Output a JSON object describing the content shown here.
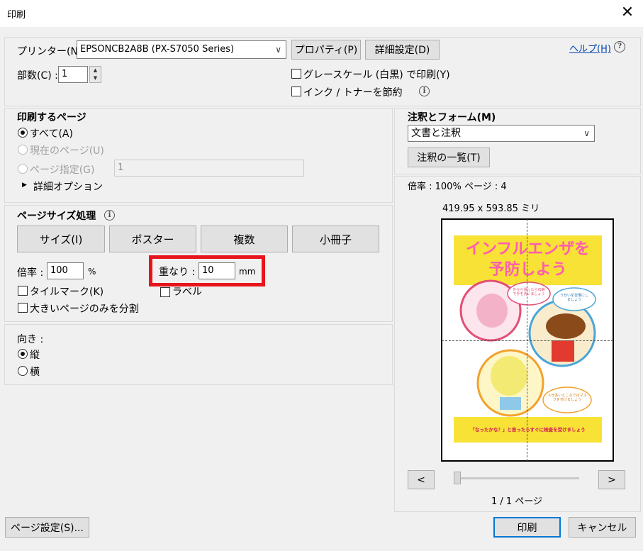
{
  "window": {
    "title": "印刷",
    "close_glyph": "✕"
  },
  "printer": {
    "label": "プリンター(N) :",
    "selected": "EPSONCB2A8B (PX-S7050 Series)",
    "properties_button": "プロパティ(P)",
    "advanced_button": "詳細設定(D)",
    "help_link": "ヘルプ(H)",
    "help_icon": "?",
    "copies_label": "部数(C) :",
    "copies_value": "1",
    "grayscale_label": "グレースケール (白黒) で印刷(Y)",
    "save_ink_label": "インク / トナーを節約"
  },
  "pages_to_print": {
    "title": "印刷するページ",
    "all": "すべて(A)",
    "current": "現在のページ(U)",
    "pages": "ページ指定(G)",
    "pages_value": "1",
    "more_options": "詳細オプション",
    "triangle": "▶"
  },
  "page_sizing": {
    "title": "ページサイズ処理",
    "buttons": [
      "サイズ(I)",
      "ポスター",
      "複数",
      "小冊子"
    ],
    "scale_label": "倍率 :",
    "scale_value": "100",
    "scale_unit": "%",
    "overlap_label": "重なり :",
    "overlap_value": "10",
    "overlap_unit": "mm",
    "tile_marks": "タイルマーク(K)",
    "labels": "ラベル",
    "large_pages_only": "大きいページのみを分割"
  },
  "orientation": {
    "title": "向き :",
    "portrait": "縦",
    "landscape": "横"
  },
  "comments_forms": {
    "title": "注釈とフォーム(M)",
    "selected": "文書と注釈",
    "summarize_button": "注釈の一覧(T)"
  },
  "preview": {
    "scale_info": "倍率 : 100% ページ : 4",
    "dimensions": "419.95 x 593.85 ミリ",
    "page_counter": "1 / 1 ページ",
    "prev": "<",
    "next": ">",
    "poster": {
      "title_line1": "インフルエンザを",
      "title_line2": "予防しよう",
      "bubble1": "外から帰ったら石鹸で手を洗いましょう",
      "bubble2": "うがいを習慣にしましょう",
      "bubble3": "人が多いところではマスクを付けましょう",
      "footer": "「なったかな？」と思ったらすぐに検査を受けましょう"
    }
  },
  "footer": {
    "page_setup_button": "ページ設定(S)...",
    "print_button": "印刷",
    "cancel_button": "キャンセル"
  },
  "colors": {
    "highlight": "#e8141b",
    "poster_yellow": "#f7e235",
    "poster_pink": "#ff5cb0",
    "accent_blue": "#0078d7"
  }
}
